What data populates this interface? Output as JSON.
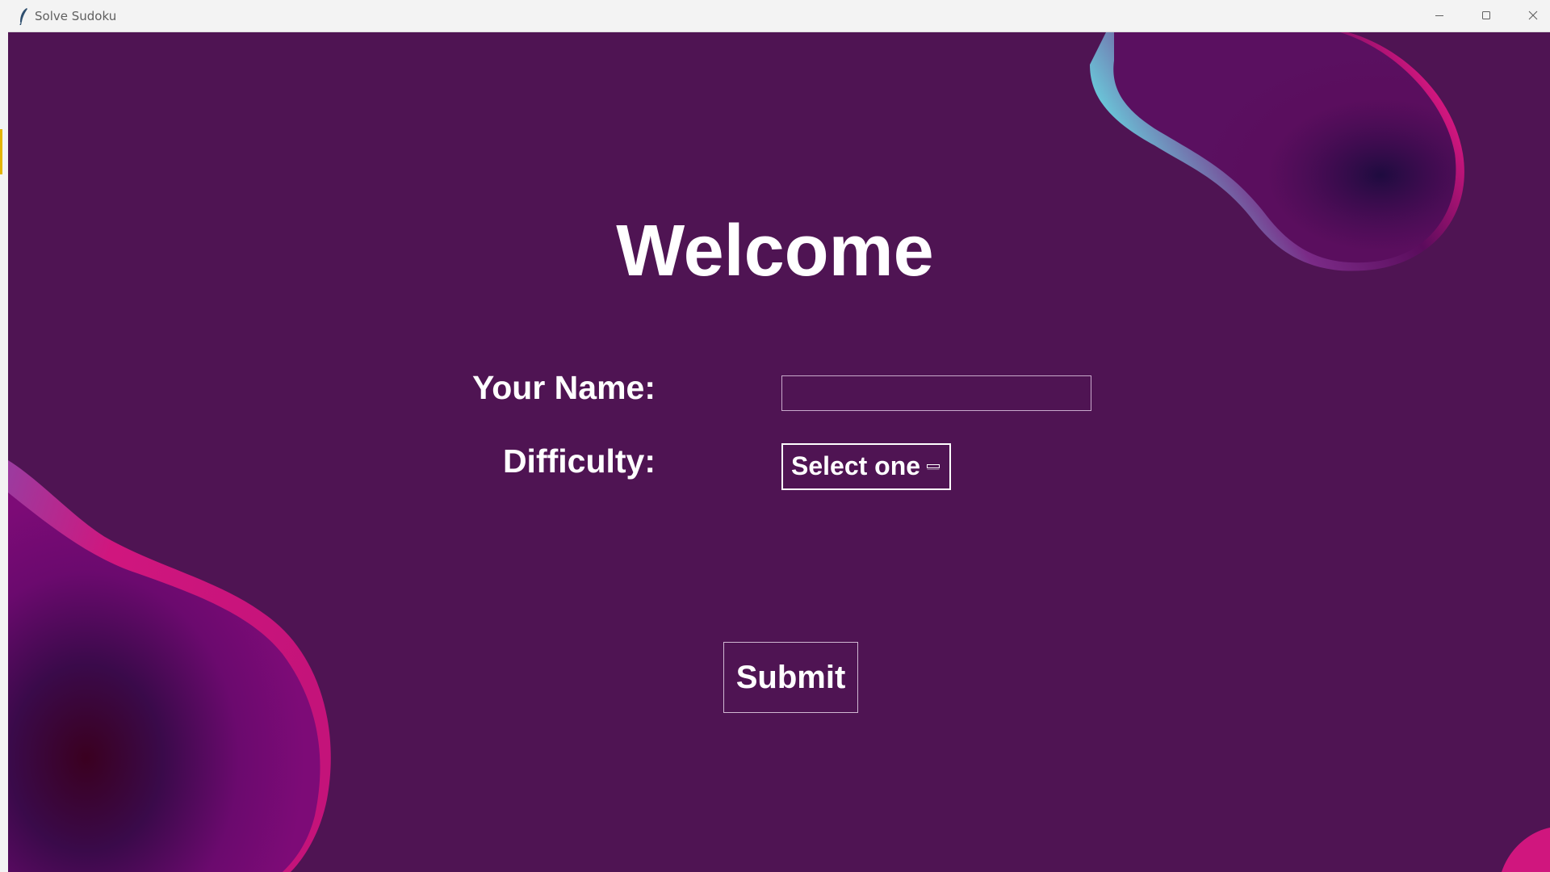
{
  "window": {
    "title": "Solve Sudoku",
    "icons": {
      "app": "feather-icon",
      "minimize": "minimize-icon",
      "maximize": "maximize-icon",
      "close": "close-icon"
    }
  },
  "form": {
    "heading": "Welcome",
    "name_label": "Your Name:",
    "name_value": "",
    "difficulty_label": "Difficulty:",
    "difficulty_selected": "Select one",
    "submit_label": "Submit"
  },
  "colors": {
    "background": "#4f1453",
    "text": "#ffffff",
    "blob_magenta": "#d0167e",
    "blob_cyan": "#6ac7d9"
  }
}
